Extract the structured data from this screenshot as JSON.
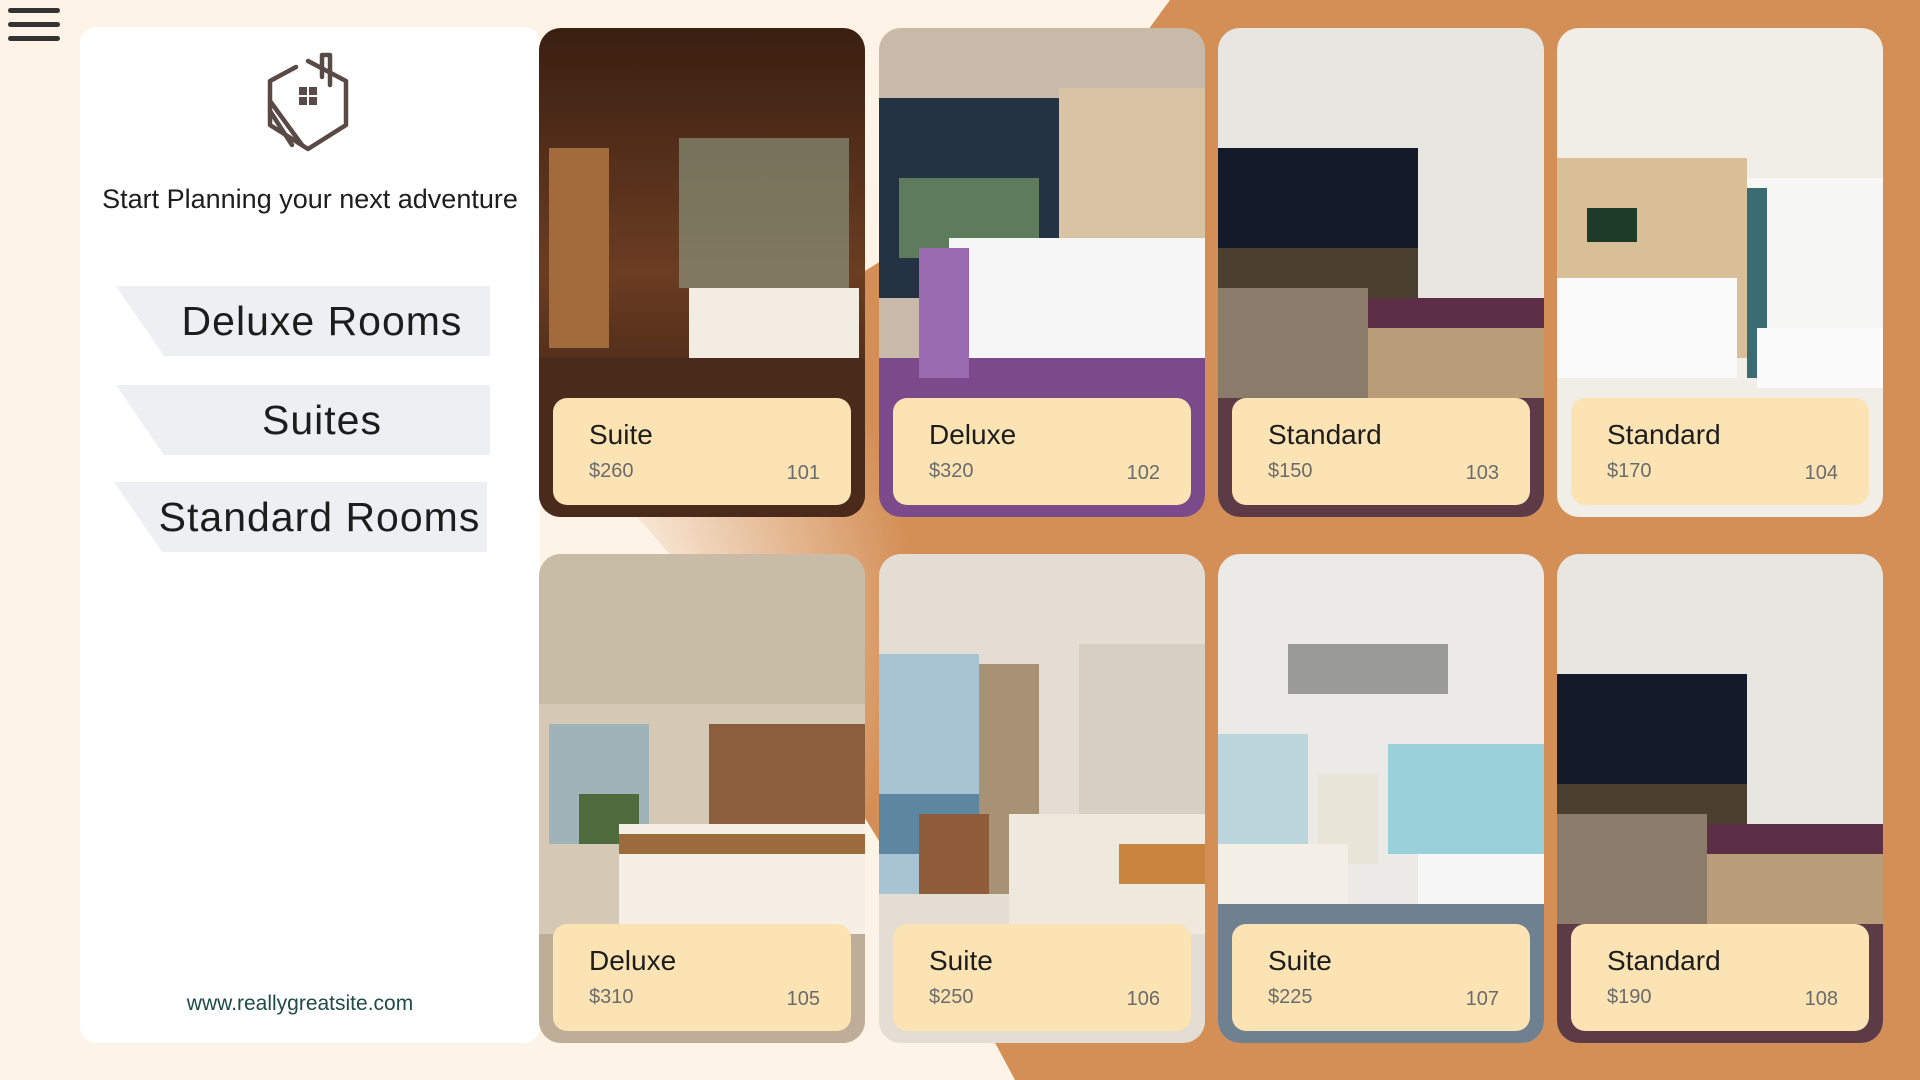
{
  "menu": {
    "icon": "hamburger-menu-icon"
  },
  "sidebar": {
    "logo_icon": "house-logo-icon",
    "tagline": "Start Planning your next adventure",
    "nav": [
      {
        "label": "Deluxe Rooms"
      },
      {
        "label": "Suites"
      },
      {
        "label": "Standard Rooms"
      }
    ],
    "website": "www.reallygreatsite.com"
  },
  "rooms": [
    {
      "type": "Suite",
      "price": "$260",
      "number": "101"
    },
    {
      "type": "Deluxe",
      "price": "$320",
      "number": "102"
    },
    {
      "type": "Standard",
      "price": "$150",
      "number": "103"
    },
    {
      "type": "Standard",
      "price": "$170",
      "number": "104"
    },
    {
      "type": "Deluxe",
      "price": "$310",
      "number": "105"
    },
    {
      "type": "Suite",
      "price": "$250",
      "number": "106"
    },
    {
      "type": "Suite",
      "price": "$225",
      "number": "107"
    },
    {
      "type": "Standard",
      "price": "$190",
      "number": "108"
    }
  ],
  "colors": {
    "background": "#fdf3e6",
    "accent": "#d48f56",
    "card_label": "#fbe3b4",
    "nav_button": "#eeeff2",
    "url_text": "#1f4b47"
  }
}
